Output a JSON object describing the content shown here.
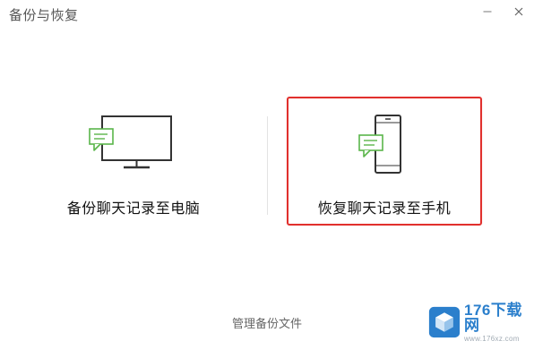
{
  "window": {
    "title": "备份与恢复"
  },
  "options": {
    "backup_label": "备份聊天记录至电脑",
    "restore_label": "恢复聊天记录至手机"
  },
  "footer": {
    "manage_label": "管理备份文件"
  },
  "watermark": {
    "brand": "176下载网",
    "url": "www.176xz.com"
  },
  "colors": {
    "accent_green": "#5ab54a",
    "highlight_red": "#e1302d",
    "icon_gray": "#333333",
    "brand_blue": "#1a75c8"
  },
  "icons": [
    "minimize-icon",
    "close-icon",
    "monitor-chat-icon",
    "phone-chat-icon",
    "cube-logo-icon"
  ]
}
